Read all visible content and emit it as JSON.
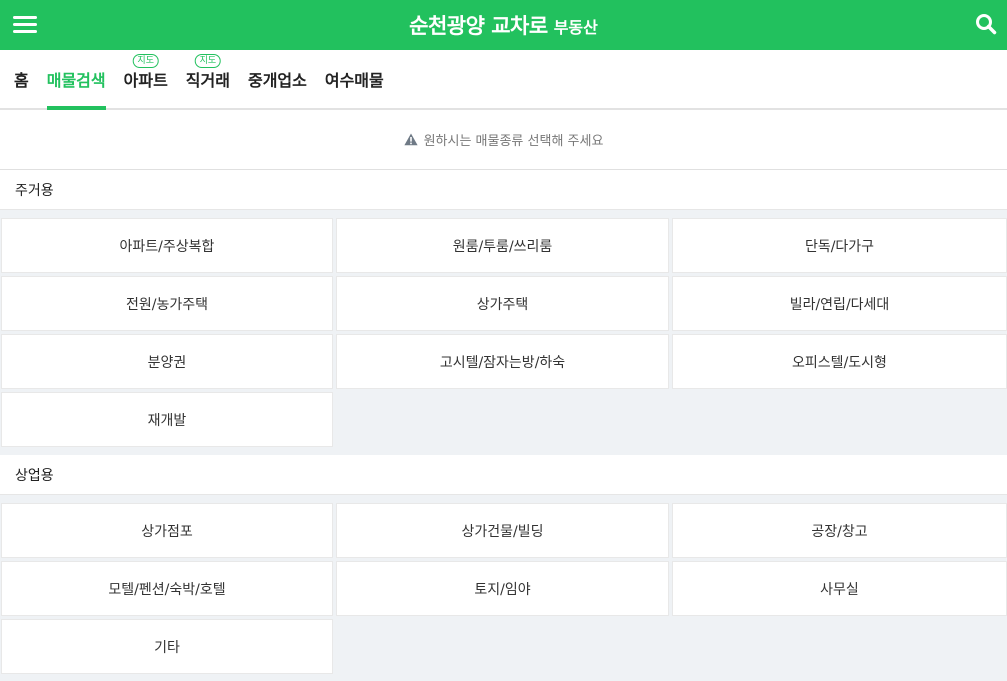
{
  "header": {
    "title_main": "순천광양 교차로",
    "title_sub": "부동산",
    "menu_icon": "hamburger-menu-icon",
    "search_icon": "search-icon",
    "brand_color": "#22c15e"
  },
  "nav": {
    "tabs": [
      {
        "label": "홈",
        "badge": ""
      },
      {
        "label": "매물검색",
        "badge": ""
      },
      {
        "label": "아파트",
        "badge": "지도"
      },
      {
        "label": "직거래",
        "badge": "지도"
      },
      {
        "label": "중개업소",
        "badge": ""
      },
      {
        "label": "여수매물",
        "badge": ""
      }
    ],
    "active_index": 1
  },
  "notice": {
    "text": "원하시는 매물종류 선택해 주세요",
    "icon": "warning-icon"
  },
  "sections": [
    {
      "title": "주거용",
      "items": [
        "아파트/주상복합",
        "원룸/투룸/쓰리룸",
        "단독/다가구",
        "전원/농가주택",
        "상가주택",
        "빌라/연립/다세대",
        "분양권",
        "고시텔/잠자는방/하숙",
        "오피스텔/도시형",
        "재개발"
      ]
    },
    {
      "title": "상업용",
      "items": [
        "상가점포",
        "상가건물/빌딩",
        "공장/창고",
        "모텔/펜션/숙박/호텔",
        "토지/임야",
        "사무실",
        "기타"
      ]
    }
  ]
}
